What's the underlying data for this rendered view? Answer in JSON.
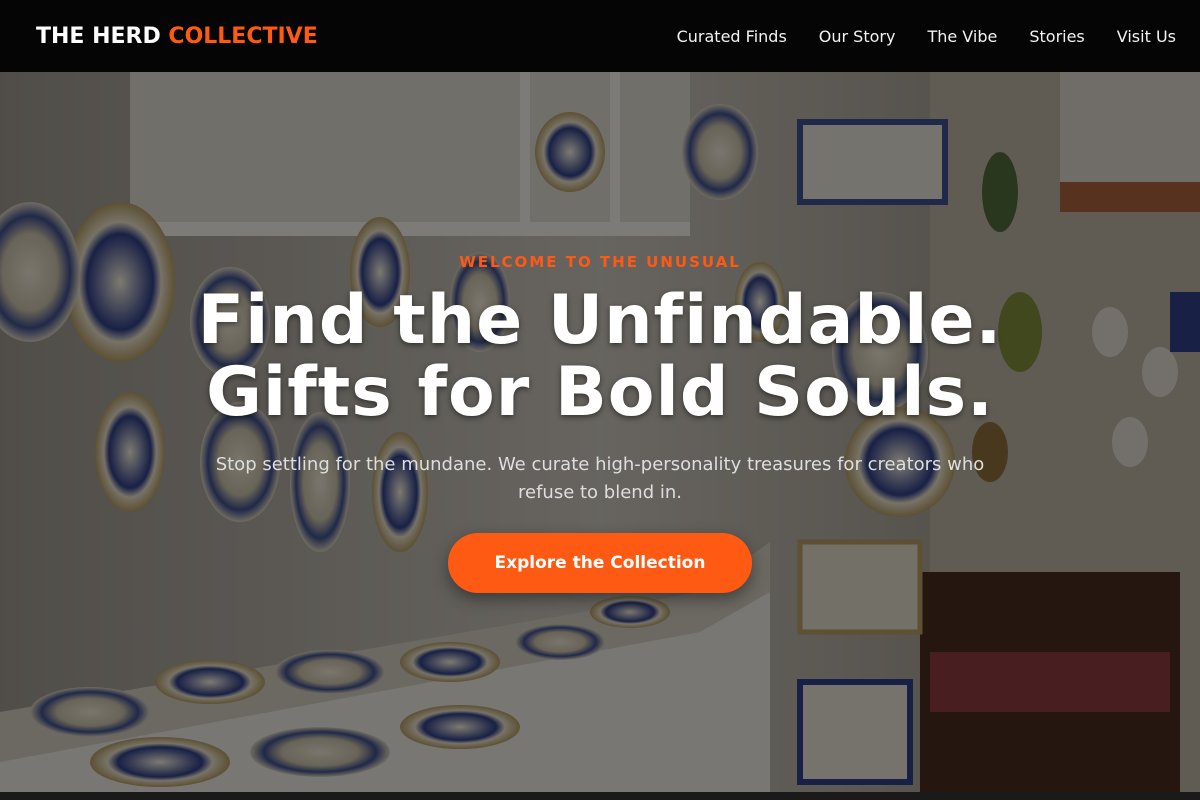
{
  "brand": {
    "name_primary": "THE HERD",
    "name_accent": "COLLECTIVE",
    "accent_color": "#ff5a14"
  },
  "nav": {
    "items": [
      {
        "label": "Curated Finds"
      },
      {
        "label": "Our Story"
      },
      {
        "label": "The Vibe"
      },
      {
        "label": "Stories"
      },
      {
        "label": "Visit Us"
      }
    ]
  },
  "hero": {
    "eyebrow": "WELCOME TO THE UNUSUAL",
    "headline_line1": "Find the Unfindable.",
    "headline_line2": "Gifts for Bold Souls.",
    "subtext": "Stop settling for the mundane. We curate high-personality treasures for creators who refuse to blend in.",
    "cta_label": "Explore the Collection",
    "background_image": "ceramic-shop-photo"
  }
}
